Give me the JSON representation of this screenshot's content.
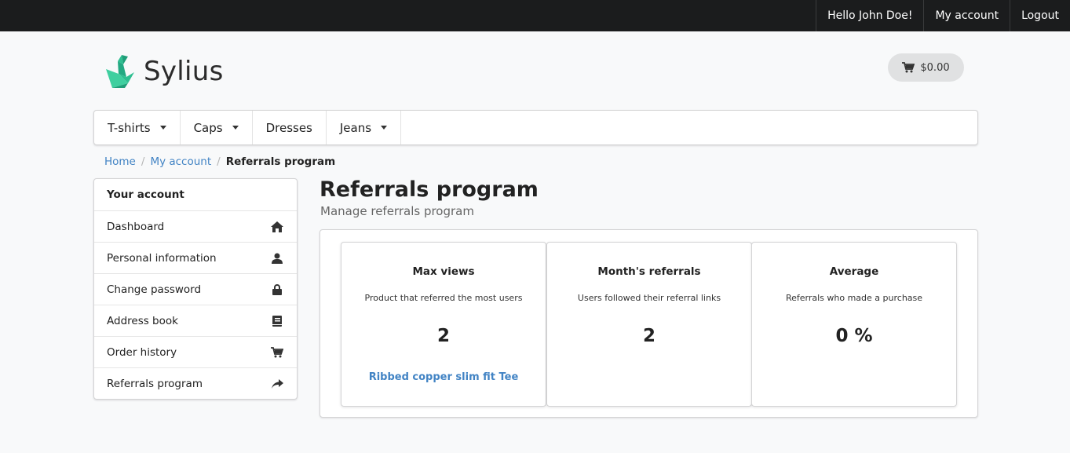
{
  "topbar": {
    "greeting": "Hello John Doe!",
    "account": "My account",
    "logout": "Logout"
  },
  "header": {
    "logo_text": "Sylius",
    "cart_total": "$0.00"
  },
  "nav": {
    "items": [
      {
        "label": "T-shirts",
        "has_dropdown": true
      },
      {
        "label": "Caps",
        "has_dropdown": true
      },
      {
        "label": "Dresses",
        "has_dropdown": false
      },
      {
        "label": "Jeans",
        "has_dropdown": true
      }
    ]
  },
  "breadcrumb": {
    "home": "Home",
    "account": "My account",
    "current": "Referrals program"
  },
  "sidebar": {
    "header": "Your account",
    "items": [
      {
        "label": "Dashboard",
        "icon": "home-icon"
      },
      {
        "label": "Personal information",
        "icon": "user-icon"
      },
      {
        "label": "Change password",
        "icon": "lock-icon"
      },
      {
        "label": "Address book",
        "icon": "book-icon"
      },
      {
        "label": "Order history",
        "icon": "cart-icon"
      },
      {
        "label": "Referrals program",
        "icon": "share-icon"
      }
    ]
  },
  "page": {
    "title": "Referrals program",
    "subtitle": "Manage referrals program"
  },
  "stats": [
    {
      "title": "Max views",
      "description": "Product that referred the most users",
      "value": "2",
      "link": "Ribbed copper slim fit Tee"
    },
    {
      "title": "Month's referrals",
      "description": "Users followed their referral links",
      "value": "2"
    },
    {
      "title": "Average",
      "description": "Referrals who made a purchase",
      "value": "0 %"
    }
  ],
  "colors": {
    "topbar": "#1b1c1d",
    "link": "#4183c4",
    "logo_green": "#2ebf91"
  }
}
